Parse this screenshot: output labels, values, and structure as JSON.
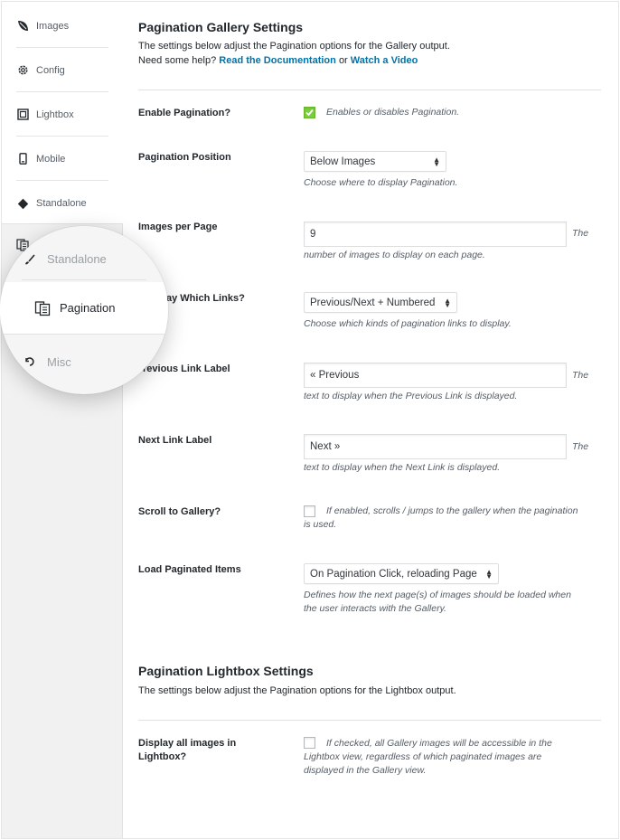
{
  "sidebar": {
    "items": [
      {
        "label": "Images",
        "icon": "leaf-icon"
      },
      {
        "label": "Config",
        "icon": "gear-icon"
      },
      {
        "label": "Lightbox",
        "icon": "lightbox-icon"
      },
      {
        "label": "Mobile",
        "icon": "mobile-icon"
      },
      {
        "label": "Standalone",
        "icon": "diamond-icon"
      }
    ]
  },
  "zoom": {
    "items": [
      {
        "label": "Standalone",
        "icon": "brush-icon"
      },
      {
        "label": "Pagination",
        "icon": "pagination-icon"
      },
      {
        "label": "Misc",
        "icon": "misc-icon"
      }
    ]
  },
  "section1": {
    "title": "Pagination Gallery Settings",
    "desc_line1": "The settings below adjust the Pagination options for the Gallery output.",
    "desc_need_help": "Need some help?",
    "link_docs": "Read the Documentation",
    "desc_or": "or",
    "link_video": "Watch a Video"
  },
  "fields": {
    "enable": {
      "label": "Enable Pagination?",
      "help": "Enables or disables Pagination.",
      "checked": true
    },
    "position": {
      "label": "Pagination Position",
      "value": "Below Images",
      "help": "Choose where to display Pagination."
    },
    "per_page": {
      "label": "Images per Page",
      "value": "9",
      "help_inline": "The",
      "help": "number of images to display on each page."
    },
    "links": {
      "label_visible": "ay Which Links?",
      "value": "Previous/Next + Numbered",
      "help": "Choose which kinds of pagination links to display."
    },
    "prev_label": {
      "label_visible": "revious Link Label",
      "value": "« Previous",
      "help_inline": "The",
      "help": "text to display when the Previous Link is displayed."
    },
    "next_label": {
      "label": "Next Link Label",
      "value": "Next »",
      "help_inline": "The",
      "help": "text to display when the Next Link is displayed."
    },
    "scroll": {
      "label": "Scroll to Gallery?",
      "help": "If enabled, scrolls / jumps to the gallery when the pagination is used.",
      "checked": false
    },
    "load": {
      "label": "Load Paginated Items",
      "value": "On Pagination Click, reloading Page",
      "help": "Defines how the next page(s) of images should be loaded when the user interacts with the Gallery."
    }
  },
  "section2": {
    "title": "Pagination Lightbox Settings",
    "desc": "The settings below adjust the Pagination options for the Lightbox output."
  },
  "lightbox_field": {
    "label": "Display all images in Lightbox?",
    "help": "If checked, all Gallery images will be accessible in the Lightbox view, regardless of which paginated images are displayed in the Gallery view.",
    "checked": false
  },
  "colors": {
    "accent_link": "#0073aa",
    "check_green": "#7ad03a"
  }
}
